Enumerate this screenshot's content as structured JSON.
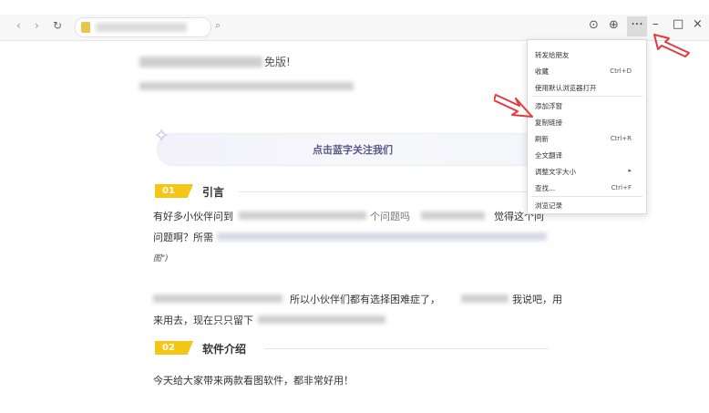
{
  "toolbar": {
    "back_icon": "‹",
    "forward_icon": "›",
    "reload_icon": "↻",
    "search_icon": "⌕",
    "download_icon": "⊙",
    "globe_icon": "⊕",
    "more_icon": "···",
    "minimize_icon": "–",
    "maximize_icon": "□",
    "close_icon": "×"
  },
  "article": {
    "title_suffix": "免版!",
    "banner_text": "点击蓝字关注我们",
    "sections": [
      {
        "num": "01",
        "title": "引言"
      },
      {
        "num": "02",
        "title": "软件介绍"
      }
    ],
    "para1_line1_start": "有好多小伙伴问到",
    "para1_line1_mid": "个问题吗",
    "para1_line1_end": "觉得这个问",
    "para1_line2_start": "问题啊？所需",
    "para1_line3": "图\")",
    "para2_line1": "所以小伙伴们都有选择困难症了，",
    "para2_line1_end": "我说吧，用",
    "para2_line2": "来用去，现在只只留下",
    "intro_text": "今天给大家带来两款看图软件，都非常好用！"
  },
  "menu": {
    "items": [
      {
        "label": "转发给朋友",
        "shortcut": ""
      },
      {
        "label": "收藏",
        "shortcut": "Ctrl+D"
      },
      {
        "label": "使用默认浏览器打开",
        "shortcut": ""
      },
      {
        "label": "添加浮窗",
        "shortcut": ""
      },
      {
        "label": "复制链接",
        "shortcut": ""
      },
      {
        "label": "刷新",
        "shortcut": "Ctrl+R"
      },
      {
        "label": "全文翻译",
        "shortcut": ""
      },
      {
        "label": "调整文字大小",
        "shortcut": "▸"
      },
      {
        "label": "查找...",
        "shortcut": "Ctrl+F"
      },
      {
        "label": "浏览记录",
        "shortcut": ""
      }
    ]
  },
  "colors": {
    "accent": "#f5c518",
    "arrow": "#e23b3b",
    "banner_text": "#5a5a88"
  }
}
